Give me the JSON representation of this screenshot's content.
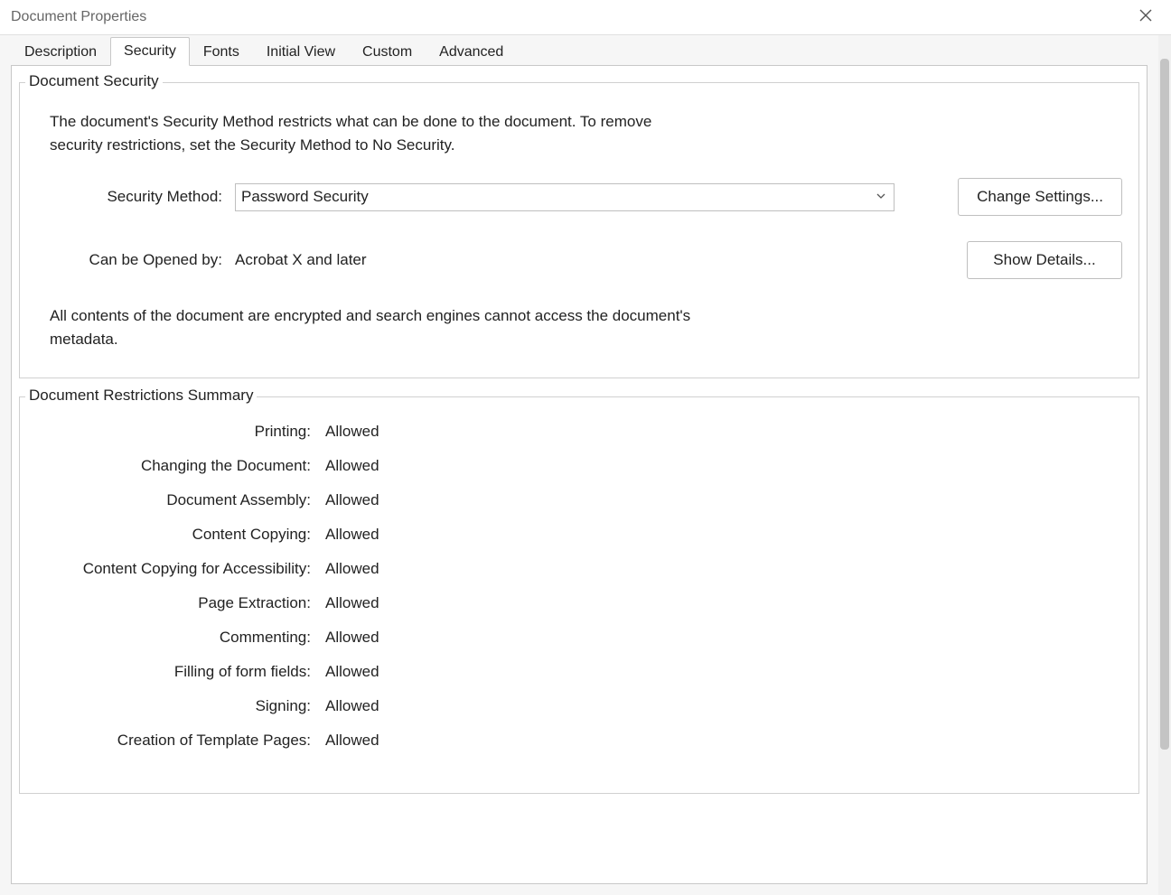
{
  "window": {
    "title": "Document Properties"
  },
  "tabs": [
    {
      "label": "Description"
    },
    {
      "label": "Security"
    },
    {
      "label": "Fonts"
    },
    {
      "label": "Initial View"
    },
    {
      "label": "Custom"
    },
    {
      "label": "Advanced"
    }
  ],
  "activeTab": "Security",
  "security": {
    "groupTitle": "Document Security",
    "description": "The document's Security Method restricts what can be done to the document. To remove security restrictions, set the Security Method to No Security.",
    "methodLabel": "Security Method:",
    "methodValue": "Password Security",
    "changeSettingsLabel": "Change Settings...",
    "openedByLabel": "Can be Opened by:",
    "openedByValue": "Acrobat X and later",
    "showDetailsLabel": "Show Details...",
    "encryptionNote": "All contents of the document are encrypted and search engines cannot access the document's metadata."
  },
  "restrictions": {
    "groupTitle": "Document Restrictions Summary",
    "items": [
      {
        "label": "Printing:",
        "value": "Allowed"
      },
      {
        "label": "Changing the Document:",
        "value": "Allowed"
      },
      {
        "label": "Document Assembly:",
        "value": "Allowed"
      },
      {
        "label": "Content Copying:",
        "value": "Allowed"
      },
      {
        "label": "Content Copying for Accessibility:",
        "value": "Allowed"
      },
      {
        "label": "Page Extraction:",
        "value": "Allowed"
      },
      {
        "label": "Commenting:",
        "value": "Allowed"
      },
      {
        "label": "Filling of form fields:",
        "value": "Allowed"
      },
      {
        "label": "Signing:",
        "value": "Allowed"
      },
      {
        "label": "Creation of Template Pages:",
        "value": "Allowed"
      }
    ]
  }
}
